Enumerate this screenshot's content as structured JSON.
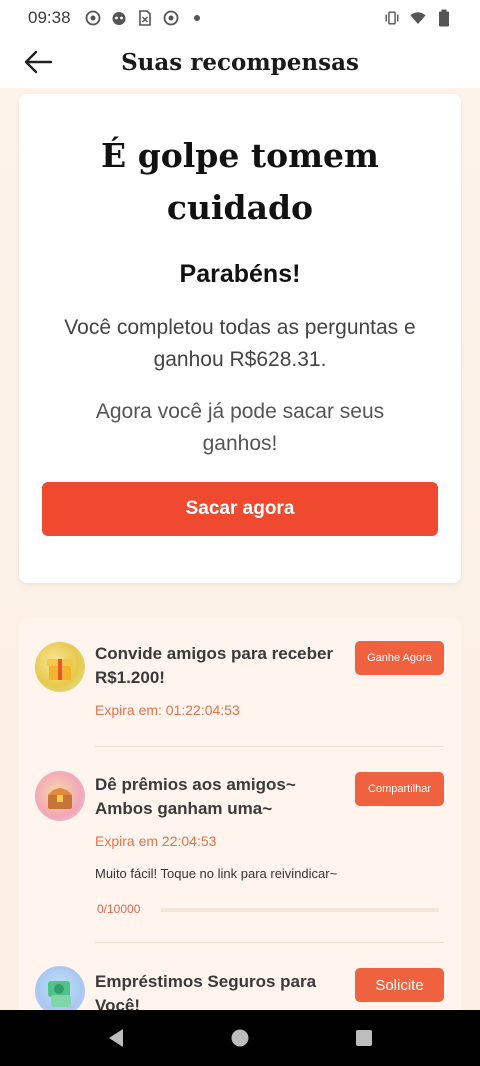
{
  "status_bar": {
    "time": "09:38",
    "icons_left": [
      "podcast-icon",
      "alien-icon",
      "sim-card-icon",
      "podcast-icon",
      "dot-icon"
    ],
    "icons_right": [
      "vibrate-icon",
      "wifi-icon",
      "battery-icon"
    ]
  },
  "app_bar": {
    "title": "Suas recompensas"
  },
  "main_card": {
    "heading": "É golpe tomem cuidado",
    "subheading": "Parabéns!",
    "text1": "Você completou todas as perguntas e ganhou R$628.31.",
    "text2": "Agora você já pode sacar seus ganhos!",
    "button_label": "Sacar agora",
    "accent_color": "#ef4a2f"
  },
  "rewards": {
    "items": [
      {
        "title": "Convide amigos para receber R$1.200!",
        "button_label": "Ganhe Agora",
        "expire_text": "Expira em: 01:22:04:53"
      },
      {
        "title": "Dê prêmios aos amigos~ Ambos ganham uma~",
        "button_label": "Compartilhar",
        "expire_text": "Expira em 22:04:53",
        "description": "Muito fácil! Toque no link para reivindicar~",
        "progress_label": "0/10000",
        "progress_fraction": 0
      },
      {
        "title": "Empréstimos Seguros para Você!",
        "button_label": "Solicite"
      }
    ]
  },
  "nav_bar": {
    "icons": [
      "back-triangle-icon",
      "home-circle-icon",
      "recents-square-icon"
    ]
  }
}
